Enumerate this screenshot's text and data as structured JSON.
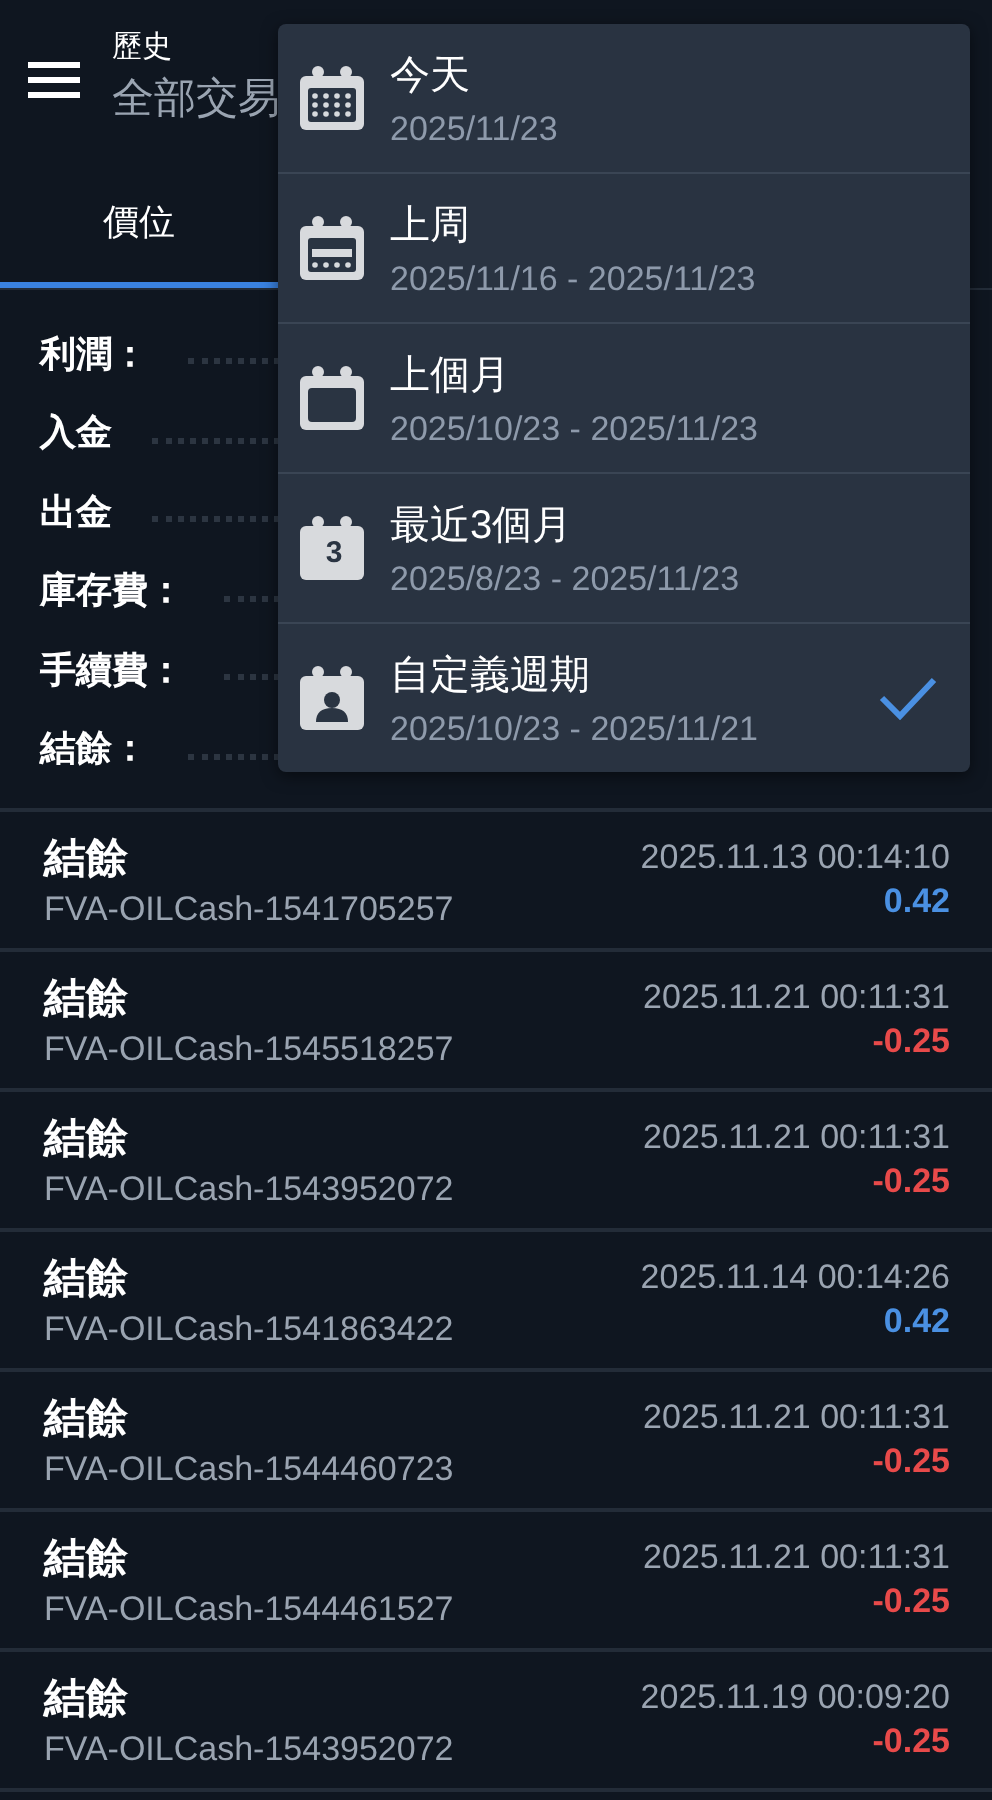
{
  "header": {
    "title": "歷史",
    "subtitle": "全部交易"
  },
  "tabs": [
    {
      "label": "價位",
      "selected": true
    }
  ],
  "summary": [
    {
      "label": "利潤："
    },
    {
      "label": "入金"
    },
    {
      "label": "出金"
    },
    {
      "label": "庫存費："
    },
    {
      "label": "手續費："
    },
    {
      "label": "結餘："
    }
  ],
  "period_menu": [
    {
      "kind": "day",
      "label": "今天",
      "range": "2025/11/23",
      "selected": false
    },
    {
      "kind": "week",
      "label": "上周",
      "range": "2025/11/16 - 2025/11/23",
      "selected": false
    },
    {
      "kind": "month",
      "label": "上個月",
      "range": "2025/10/23 - 2025/11/23",
      "selected": false
    },
    {
      "kind": "quarter",
      "label": "最近3個月",
      "range": "2025/8/23 - 2025/11/23",
      "icon_text": "3",
      "selected": false
    },
    {
      "kind": "custom",
      "label": "自定義週期",
      "range": "2025/10/23 - 2025/11/21",
      "selected": true
    }
  ],
  "deals": [
    {
      "type": "結餘",
      "symbol": "FVA-OILCash-1541705257",
      "time": "2025.11.13 00:14:10",
      "amount": "0.42",
      "color": "#4a90e2"
    },
    {
      "type": "結餘",
      "symbol": "FVA-OILCash-1545518257",
      "time": "2025.11.21 00:11:31",
      "amount": "-0.25",
      "color": "#e84a4a"
    },
    {
      "type": "結餘",
      "symbol": "FVA-OILCash-1543952072",
      "time": "2025.11.21 00:11:31",
      "amount": "-0.25",
      "color": "#e84a4a"
    },
    {
      "type": "結餘",
      "symbol": "FVA-OILCash-1541863422",
      "time": "2025.11.14 00:14:26",
      "amount": "0.42",
      "color": "#4a90e2"
    },
    {
      "type": "結餘",
      "symbol": "FVA-OILCash-1544460723",
      "time": "2025.11.21 00:11:31",
      "amount": "-0.25",
      "color": "#e84a4a"
    },
    {
      "type": "結餘",
      "symbol": "FVA-OILCash-1544461527",
      "time": "2025.11.21 00:11:31",
      "amount": "-0.25",
      "color": "#e84a4a"
    },
    {
      "type": "結餘",
      "symbol": "FVA-OILCash-1543952072",
      "time": "2025.11.19 00:09:20",
      "amount": "-0.25",
      "color": "#e84a4a"
    }
  ]
}
